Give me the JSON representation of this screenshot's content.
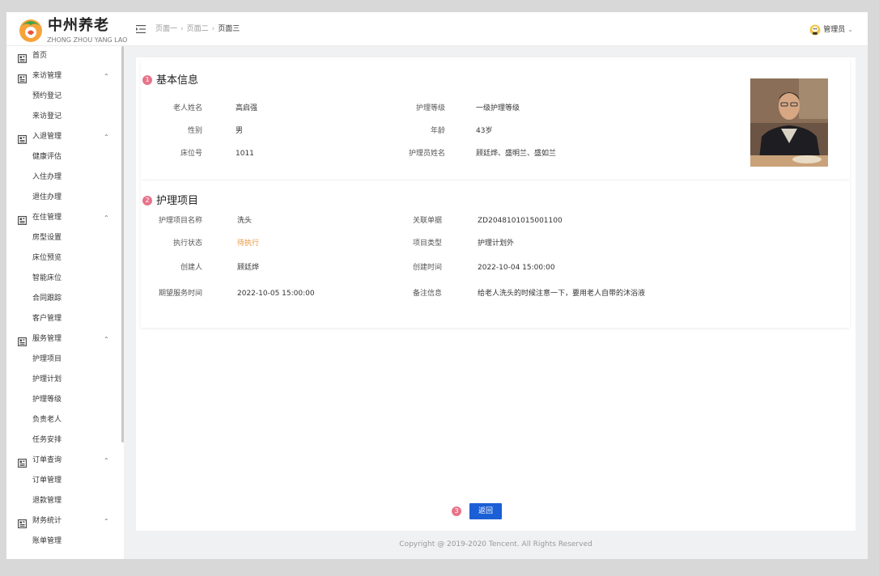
{
  "app": {
    "logo_title": "中州养老",
    "logo_subtitle": "ZHONG ZHOU YANG LAO"
  },
  "header": {
    "breadcrumb": [
      "页面一",
      "页面二",
      "页面三"
    ],
    "user_name": "管理员"
  },
  "sidebar": {
    "groups": [
      {
        "label": "首页",
        "children": []
      },
      {
        "label": "来访管理",
        "children": [
          "预约登记",
          "来访登记"
        ]
      },
      {
        "label": "入退管理",
        "children": [
          "健康评估",
          "入住办理",
          "退住办理"
        ]
      },
      {
        "label": "在住管理",
        "children": [
          "房型设置",
          "床位预览",
          "智能床位",
          "合同跟踪",
          "客户管理"
        ]
      },
      {
        "label": "服务管理",
        "children": [
          "护理项目",
          "护理计划",
          "护理等级",
          "负责老人",
          "任务安排"
        ]
      },
      {
        "label": "订单查询",
        "children": [
          "订单管理",
          "退款管理"
        ]
      },
      {
        "label": "财务统计",
        "children": [
          "账单管理"
        ]
      }
    ]
  },
  "basic_info": {
    "number": "1",
    "title": "基本信息",
    "fields": {
      "name_label": "老人姓名",
      "name": "高启强",
      "gender_label": "性别",
      "gender": "男",
      "bed_label": "床位号",
      "bed": "1011",
      "level_label": "护理等级",
      "level": "一级护理等级",
      "age_label": "年龄",
      "age": "43岁",
      "nurse_label": "护理员姓名",
      "nurse": "顾廷烨、盛明兰、盛如兰"
    }
  },
  "care_item": {
    "number": "2",
    "title": "护理项目",
    "fields": {
      "item_name_label": "护理项目名称",
      "item_name": "洗头",
      "status_label": "执行状态",
      "status": "待执行",
      "creator_label": "创建人",
      "creator": "顾廷烨",
      "expected_time_label": "期望服务时间",
      "expected_time": "2022-10-05 15:00:00",
      "order_label": "关联单据",
      "order": "ZD2048101015001100",
      "type_label": "项目类型",
      "type": "护理计划外",
      "created_time_label": "创建时间",
      "created_time": "2022-10-04 15:00:00",
      "remark_label": "备注信息",
      "remark": "给老人洗头的时候注意一下，要用老人自带的沐浴液"
    }
  },
  "actions": {
    "number": "3",
    "back_label": "返回"
  },
  "footer": {
    "copyright": "Copyright @ 2019-2020 Tencent. All Rights Reserved"
  },
  "colors": {
    "primary": "#1b5fd6",
    "badge": "#e8748a",
    "status_pending": "#e8953a"
  }
}
